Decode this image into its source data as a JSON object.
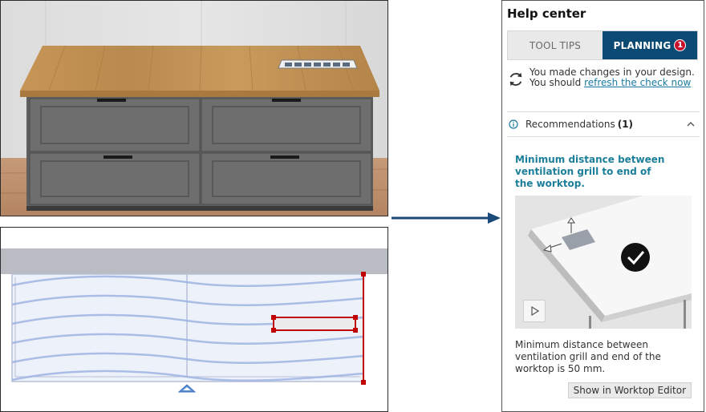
{
  "help_center": {
    "title": "Help center",
    "tabs": [
      {
        "label": "TOOL TIPS",
        "active": false
      },
      {
        "label": "PLANNING",
        "active": true,
        "badge": "1"
      }
    ],
    "refresh": {
      "line1": "You made changes in your design.",
      "line2_prefix": "You should ",
      "link": "refresh the check now"
    },
    "recommendations": {
      "label": "Recommendations",
      "count": "(1)",
      "expanded": true,
      "item": {
        "title": "Minimum distance between ventilation grill to end of the worktop.",
        "description": "Minimum distance between ventilation grill and end of the worktop is 50 mm.",
        "button": "Show in Worktop Editor"
      }
    }
  },
  "icons": {
    "refresh": "refresh-icon",
    "info": "info-icon",
    "chevron": "chevron-up-icon",
    "play": "play-icon",
    "check": "checkmark-icon",
    "arrow": "arrow-right-icon"
  },
  "colors": {
    "accent": "#0b4a72",
    "badge": "#c8102e",
    "link": "#1a7aa3",
    "title": "#1c7f99",
    "selection": "#c00000",
    "wood": "#b98a4e",
    "cabinet": "#6e6e6e"
  }
}
